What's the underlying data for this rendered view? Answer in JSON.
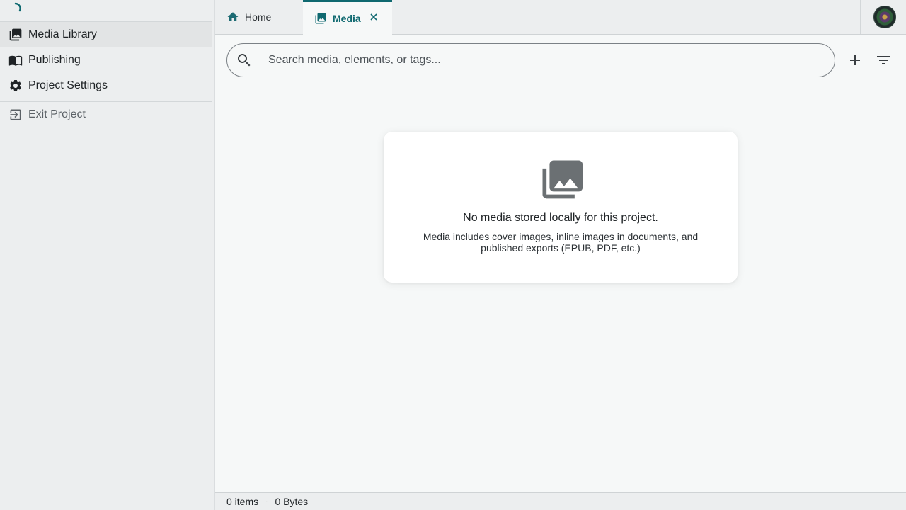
{
  "sidebar": {
    "items": [
      {
        "label": "Media Library",
        "icon": "photo-library-icon"
      },
      {
        "label": "Publishing",
        "icon": "book-icon"
      },
      {
        "label": "Project Settings",
        "icon": "gear-icon"
      },
      {
        "label": "Exit Project",
        "icon": "exit-icon"
      }
    ]
  },
  "tabs": [
    {
      "label": "Home",
      "icon": "home-icon"
    },
    {
      "label": "Media",
      "icon": "photo-library-icon",
      "active": true
    }
  ],
  "search": {
    "placeholder": "Search media, elements, or tags..."
  },
  "empty_state": {
    "title": "No media stored locally for this project.",
    "description": "Media includes cover images, inline images in documents, and published exports (EPUB, PDF, etc.)"
  },
  "status": {
    "items": "0 items",
    "size": "0 Bytes",
    "separator": "·"
  },
  "colors": {
    "accent": "#0f6970",
    "sidebar_bg": "#eceeef",
    "content_bg": "#f6f8f8"
  }
}
